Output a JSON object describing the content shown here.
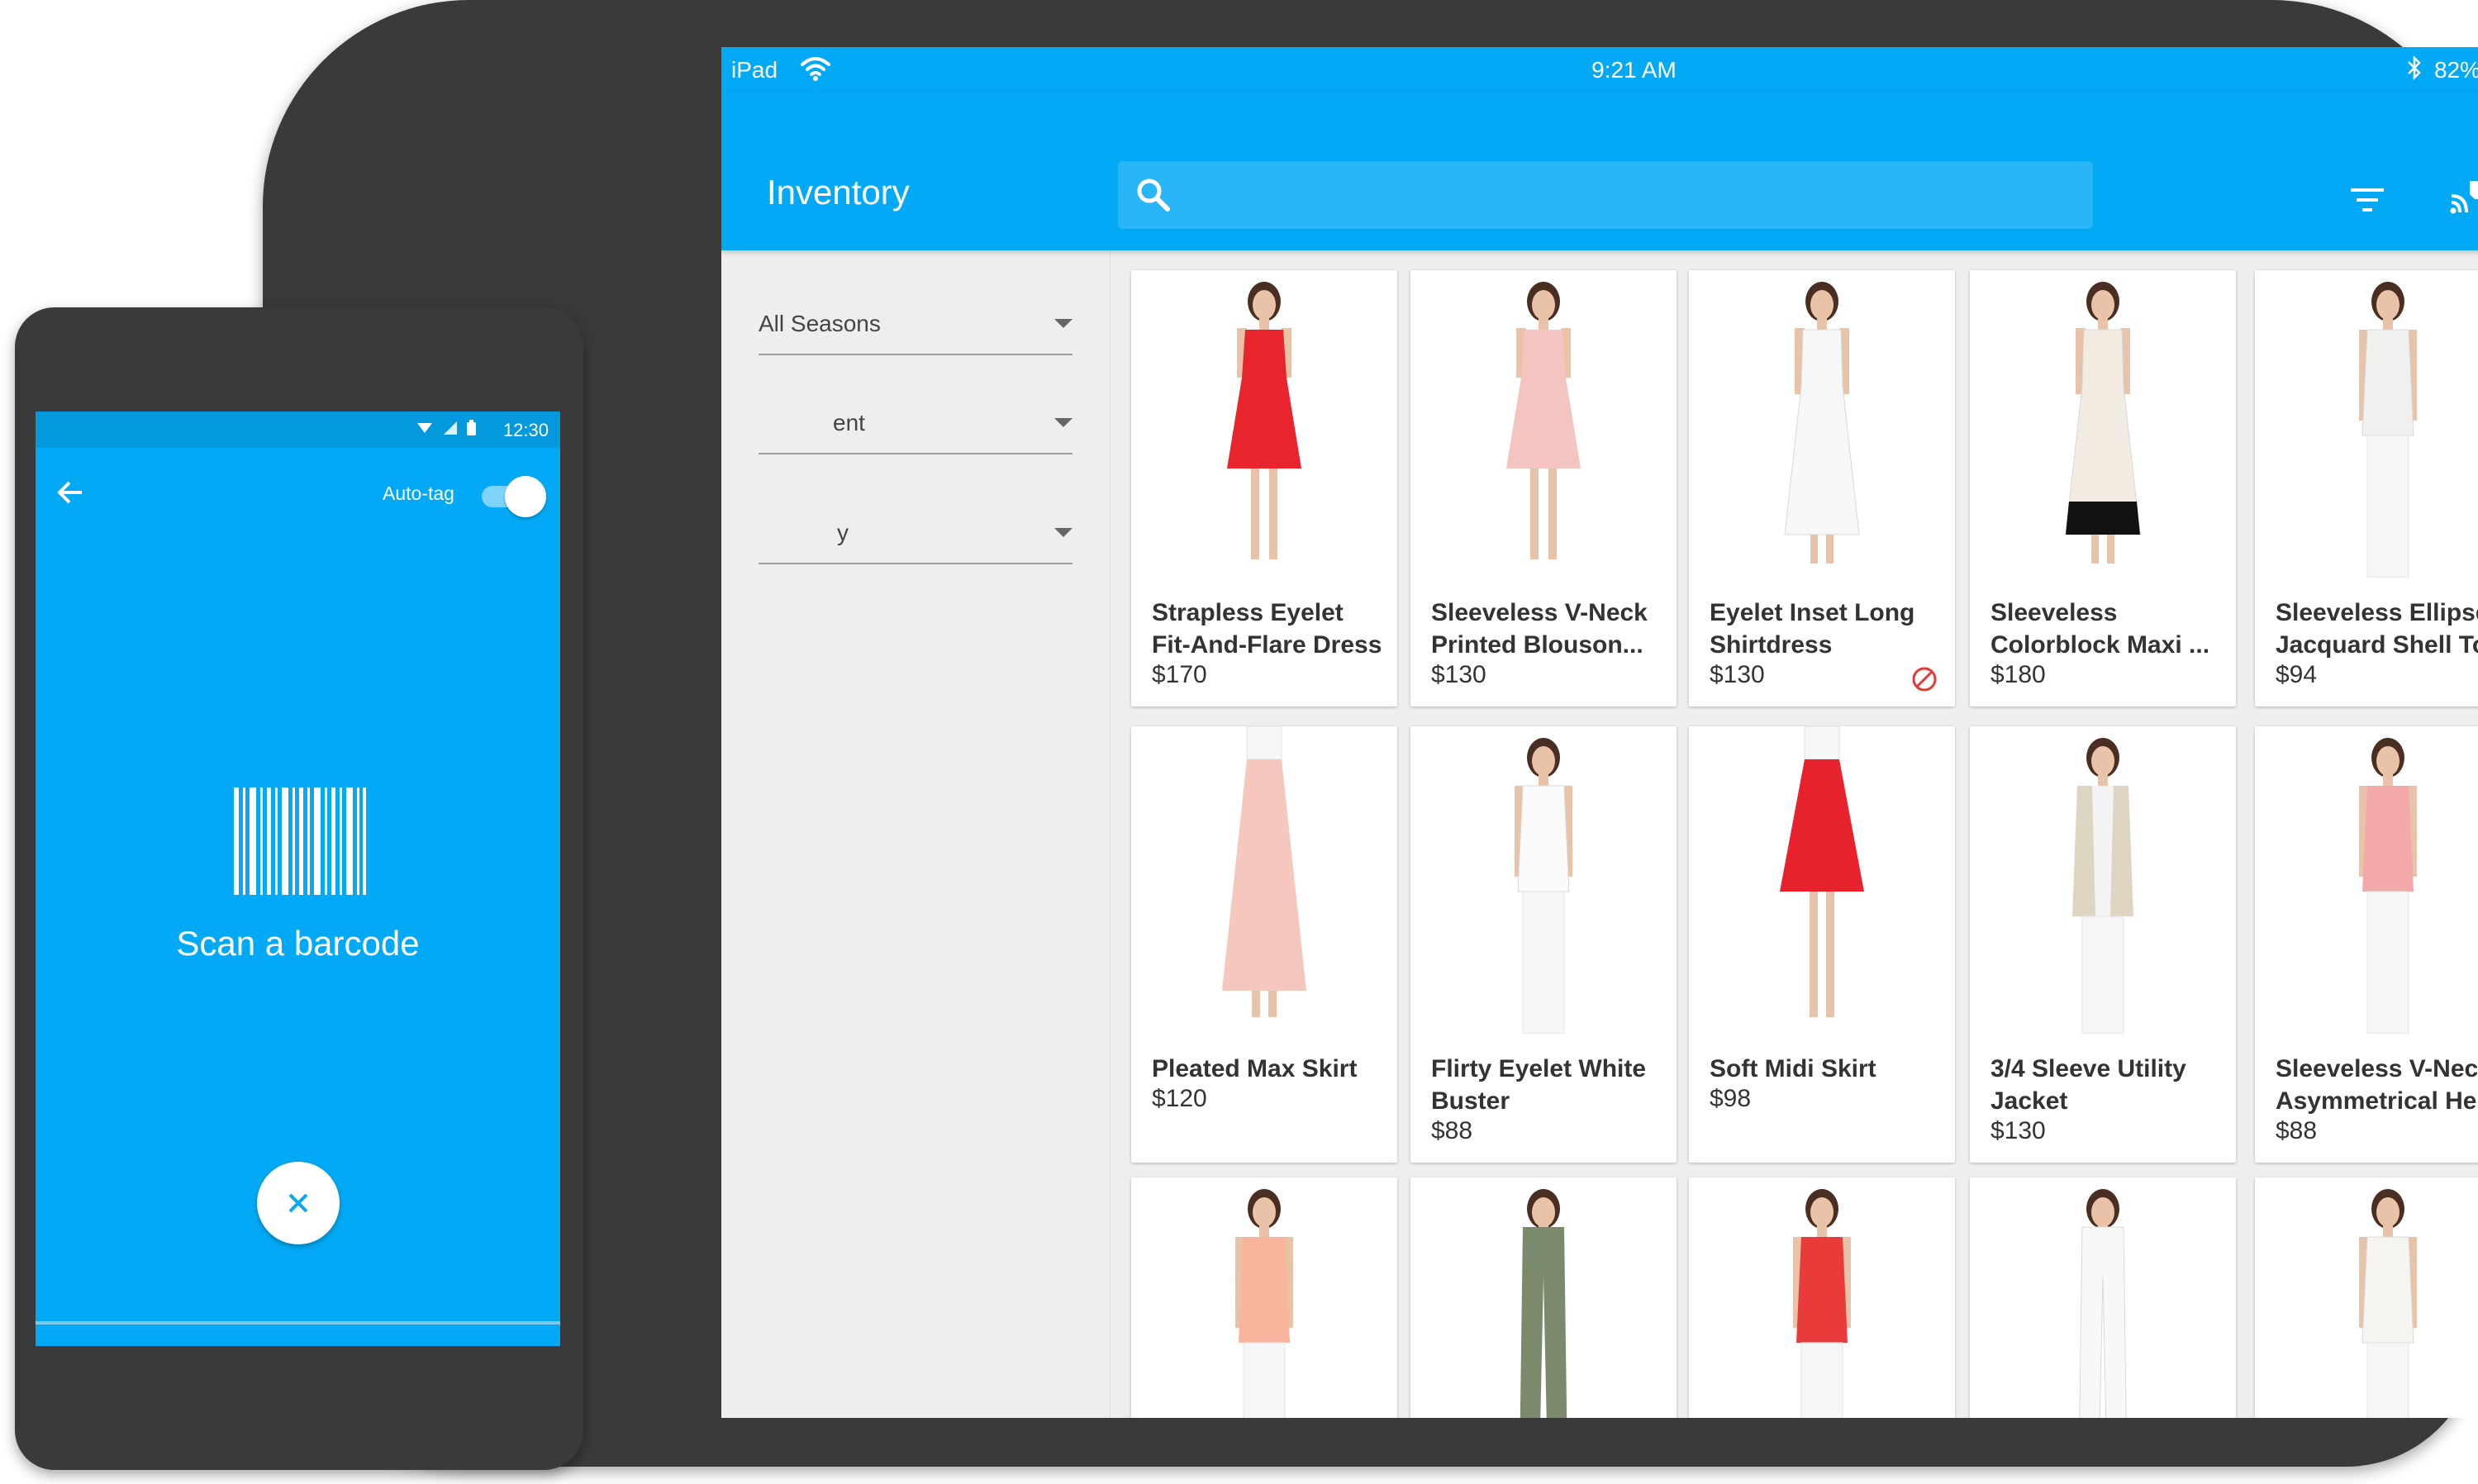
{
  "tablet": {
    "status": {
      "carrier": "iPad",
      "time": "9:21 AM",
      "battery": "82%",
      "battery_fraction": 0.82
    },
    "appbar": {
      "title": "Inventory",
      "search_placeholder": ""
    },
    "filters": [
      {
        "label": "All Seasons"
      },
      {
        "label": "ent"
      },
      {
        "label": "y"
      }
    ],
    "products": [
      {
        "name": "Strapless Eyelet Fit-And-Flare Dress",
        "price": "$170",
        "garment": "dress",
        "color": "#e8242d",
        "unavailable": false
      },
      {
        "name": "Sleeveless V-Neck Printed Blouson...",
        "price": "$130",
        "garment": "dress",
        "color": "#f4c4c0",
        "unavailable": false
      },
      {
        "name": "Eyelet Inset Long Shirtdress",
        "price": "$130",
        "garment": "long-dress",
        "color": "#f7f7f7",
        "unavailable": true
      },
      {
        "name": "Sleeveless Colorblock Maxi ...",
        "price": "$180",
        "garment": "maxi",
        "color": "#f1ebe2",
        "unavailable": false
      },
      {
        "name": "Sleeveless Ellipses Jacquard Shell Top",
        "price": "$94",
        "garment": "top",
        "color": "#f0f0ee",
        "unavailable": false
      },
      {
        "name": "Pleated Max Skirt",
        "price": "$120",
        "garment": "long-skirt",
        "color": "#f6c7bd",
        "unavailable": false
      },
      {
        "name": "Flirty Eyelet White Buster",
        "price": "$88",
        "garment": "top",
        "color": "#fafafa",
        "unavailable": false
      },
      {
        "name": "Soft Midi Skirt",
        "price": "$98",
        "garment": "skirt",
        "color": "#e8222d",
        "unavailable": false
      },
      {
        "name": "3/4 Sleeve Utility Jacket",
        "price": "$130",
        "garment": "jacket",
        "color": "#ddd5c2",
        "unavailable": false
      },
      {
        "name": "Sleeveless V-Neck Asymmetrical Helm",
        "price": "$88",
        "garment": "top",
        "color": "#f3a9a9",
        "unavailable": false
      },
      {
        "name": "",
        "price": "",
        "garment": "top",
        "color": "#f9b49d",
        "unavailable": false
      },
      {
        "name": "",
        "price": "",
        "garment": "pants",
        "color": "#7a8a6a",
        "unavailable": false
      },
      {
        "name": "",
        "price": "",
        "garment": "top",
        "color": "#ea3b3b",
        "unavailable": false
      },
      {
        "name": "",
        "price": "",
        "garment": "pants",
        "color": "#f8f8f8",
        "unavailable": false
      },
      {
        "name": "",
        "price": "",
        "garment": "top",
        "color": "#f6f4ee",
        "unavailable": false
      }
    ]
  },
  "phone": {
    "status": {
      "time": "12:30"
    },
    "toolbar": {
      "autotag_label": "Auto-tag",
      "autotag_on": true
    },
    "scan_label": "Scan a barcode"
  },
  "colors": {
    "primary": "#03a9f4",
    "primary_dark": "#0399dc",
    "search_bg": "#29b6f6",
    "device_frame": "#3a3a3a",
    "unavailable_icon": "#e53935"
  },
  "icons": [
    "search-icon",
    "filter-icon",
    "cast-tag-icon",
    "wifi-icon",
    "bluetooth-icon",
    "battery-icon",
    "back-arrow-icon",
    "barcode-icon",
    "close-icon",
    "block-icon"
  ]
}
